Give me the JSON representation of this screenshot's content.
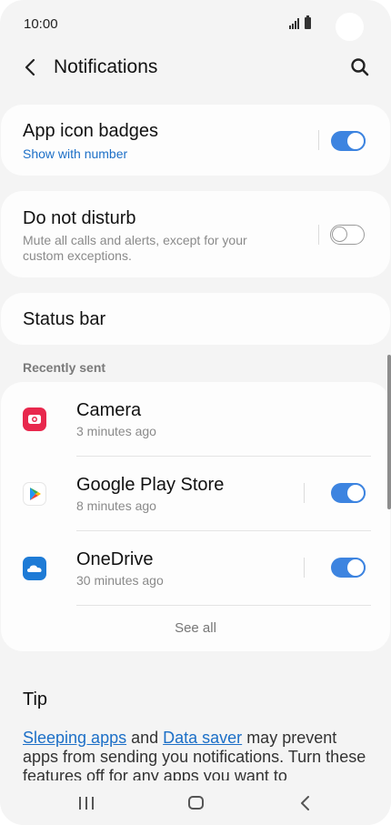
{
  "status": {
    "time": "10:00"
  },
  "header": {
    "title": "Notifications"
  },
  "app_icon_badges": {
    "title": "App icon badges",
    "subtitle": "Show with number",
    "enabled": true
  },
  "do_not_disturb": {
    "title": "Do not disturb",
    "subtitle": "Mute all calls and alerts, except for your custom exceptions.",
    "enabled": false
  },
  "status_bar": {
    "title": "Status bar"
  },
  "recently_sent": {
    "label": "Recently sent",
    "apps": [
      {
        "name": "Camera",
        "time": "3 minutes ago",
        "icon": "camera-app-icon",
        "color": "#e8284d"
      },
      {
        "name": "Google Play Store",
        "time": "8 minutes ago",
        "icon": "play-store-icon",
        "enabled": true
      },
      {
        "name": "OneDrive",
        "time": "30 minutes ago",
        "icon": "onedrive-icon",
        "color": "#1e7bd6",
        "enabled": true
      }
    ],
    "see_all": "See all"
  },
  "tip": {
    "title": "Tip",
    "link1": "Sleeping apps",
    "text1": " and ",
    "link2": "Data saver",
    "text2": " may prevent apps from sending you notifications. Turn these features off for any apps you want to"
  },
  "colors": {
    "accent": "#3d84e0",
    "link": "#1c6fc7"
  }
}
